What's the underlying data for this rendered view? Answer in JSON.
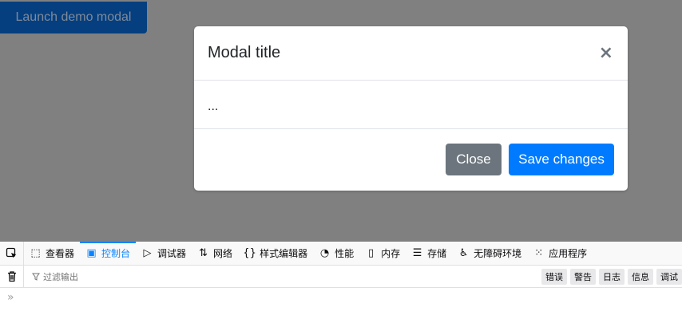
{
  "page": {
    "launch_button": "Launch demo modal"
  },
  "modal": {
    "title": "Modal title",
    "close_icon": "×",
    "body": "...",
    "close_label": "Close",
    "save_label": "Save changes"
  },
  "devtools": {
    "tabs": [
      {
        "icon": "inspector-icon",
        "glyph": "⬚",
        "label": "查看器"
      },
      {
        "icon": "console-icon",
        "glyph": "▣",
        "label": "控制台"
      },
      {
        "icon": "debugger-icon",
        "glyph": "▷",
        "label": "调试器"
      },
      {
        "icon": "network-icon",
        "glyph": "⇅",
        "label": "网络"
      },
      {
        "icon": "style-editor-icon",
        "glyph": "{}",
        "label": "样式编辑器"
      },
      {
        "icon": "performance-icon",
        "glyph": "◔",
        "label": "性能"
      },
      {
        "icon": "memory-icon",
        "glyph": "▯",
        "label": "内存"
      },
      {
        "icon": "storage-icon",
        "glyph": "☰",
        "label": "存储"
      },
      {
        "icon": "accessibility-icon",
        "glyph": "♿",
        "label": "无障碍环境"
      },
      {
        "icon": "application-icon",
        "glyph": "⁙",
        "label": "应用程序"
      }
    ],
    "filter_placeholder": "过滤输出",
    "levels": [
      "错误",
      "警告",
      "日志",
      "信息",
      "调试"
    ],
    "prompt": "»"
  },
  "colors": {
    "backdrop": "#808080",
    "primary": "#007bff",
    "secondary": "#6c757d",
    "devtools_accent": "#0a84ff"
  }
}
